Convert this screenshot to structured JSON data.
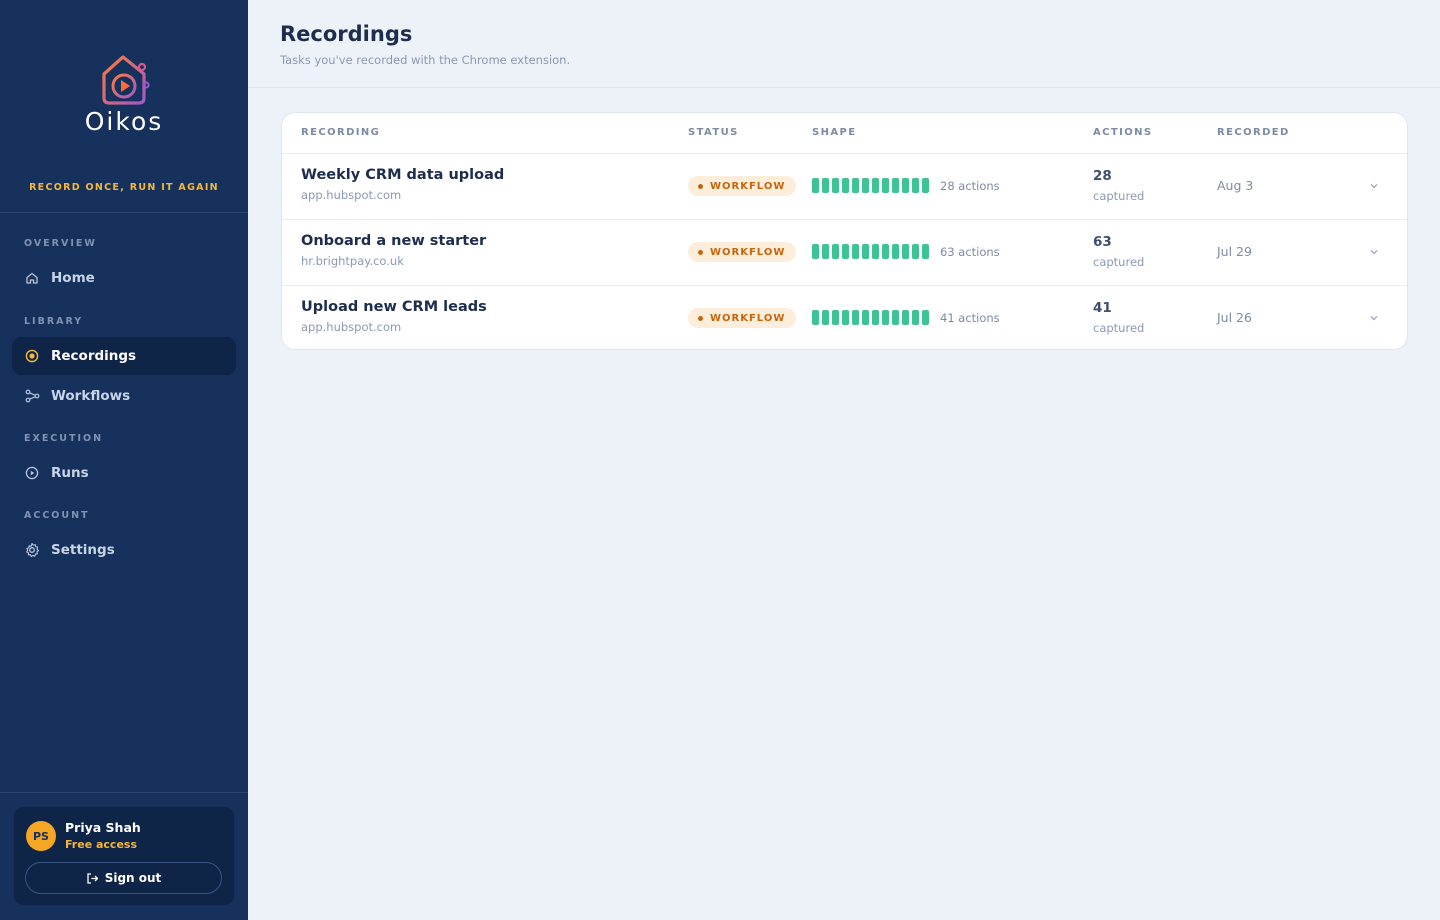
{
  "brand": {
    "name": "Oikos",
    "tagline": "RECORD ONCE, RUN IT AGAIN"
  },
  "sidebar": {
    "sections": [
      {
        "label": "OVERVIEW",
        "items": [
          {
            "label": "Home",
            "icon": "home-icon"
          }
        ]
      },
      {
        "label": "LIBRARY",
        "items": [
          {
            "label": "Recordings",
            "icon": "record-icon",
            "active": true
          },
          {
            "label": "Workflows",
            "icon": "workflow-icon"
          }
        ]
      },
      {
        "label": "EXECUTION",
        "items": [
          {
            "label": "Runs",
            "icon": "play-circle-icon"
          }
        ]
      },
      {
        "label": "ACCOUNT",
        "items": [
          {
            "label": "Settings",
            "icon": "gear-icon"
          }
        ]
      }
    ]
  },
  "user": {
    "initials": "PS",
    "name": "Priya Shah",
    "plan": "Free access",
    "signout_label": "Sign out"
  },
  "page": {
    "title": "Recordings",
    "subtitle": "Tasks you've recorded with the Chrome extension."
  },
  "table": {
    "columns": [
      "RECORDING",
      "STATUS",
      "SHAPE",
      "ACTIONS",
      "RECORDED"
    ],
    "rows": [
      {
        "title": "Weekly CRM data upload",
        "domain": "app.hubspot.com",
        "status": "WORKFLOW",
        "shape_label": "28 actions",
        "actions": "28",
        "actions_label": "captured",
        "recorded": "Aug 3"
      },
      {
        "title": "Onboard a new starter",
        "domain": "hr.brightpay.co.uk",
        "status": "WORKFLOW",
        "shape_label": "63 actions",
        "actions": "63",
        "actions_label": "captured",
        "recorded": "Jul 29"
      },
      {
        "title": "Upload new CRM leads",
        "domain": "app.hubspot.com",
        "status": "WORKFLOW",
        "shape_label": "41 actions",
        "actions": "41",
        "actions_label": "captured",
        "recorded": "Jul 26"
      }
    ]
  },
  "colors": {
    "sidebar": "#16315c",
    "accent": "#f4b73e",
    "shape_bar": "#3ec394",
    "badge_bg": "#fdeedb",
    "badge_text": "#c6650f"
  }
}
